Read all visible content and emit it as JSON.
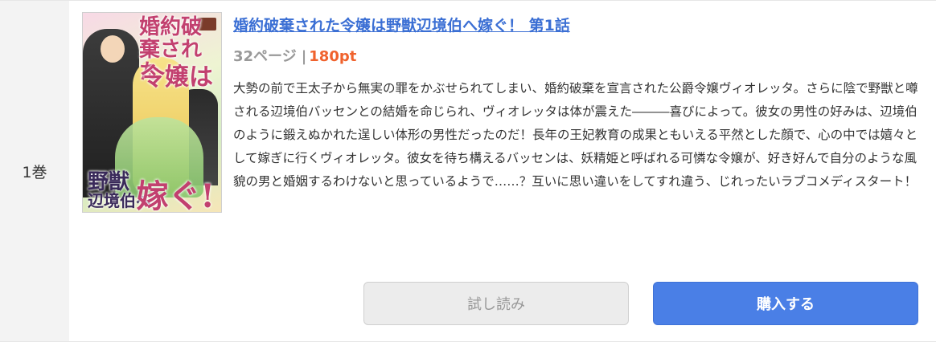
{
  "volume_label": "1巻",
  "cover": {
    "title_top": "婚約破棄された",
    "title_mid": "令嬢は",
    "title_bottom_1": "野獣",
    "title_bottom_2": "辺境伯へ",
    "title_bottom_3": "嫁ぐ!"
  },
  "item": {
    "title": "婚約破棄された令嬢は野獣辺境伯へ嫁ぐ！ 第1話",
    "pages": "32ページ",
    "separator": "|",
    "price": "180pt",
    "description": "大勢の前で王太子から無実の罪をかぶせられてしまい、婚約破棄を宣言された公爵令嬢ヴィオレッタ。さらに陰で野獣と噂される辺境伯バッセンとの結婚を命じられ、ヴィオレッタは体が震えた―――喜びによって。彼女の男性の好みは、辺境伯のように鍛えぬかれた逞しい体形の男性だったのだ！長年の王妃教育の成果ともいえる平然とした顔で、心の中では嬉々として嫁ぎに行くヴィオレッタ。彼女を待ち構えるバッセンは、妖精姫と呼ばれる可憐な令嬢が、好き好んで自分のような風貌の男と婚姻するわけないと思っているようで……？互いに思い違いをしてすれ違う、じれったいラブコメディスタート！"
  },
  "buttons": {
    "trial": "試し読み",
    "buy": "購入する"
  },
  "colors": {
    "link": "#3b6fd4",
    "price": "#f0622d",
    "buy_button": "#4a7fe6",
    "trial_button": "#ececec"
  }
}
